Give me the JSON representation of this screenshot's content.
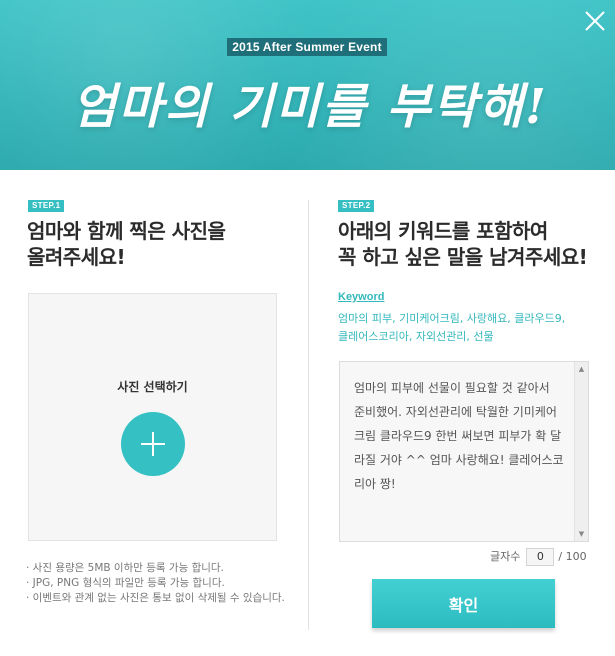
{
  "header": {
    "event_badge": "2015 After Summer Event",
    "title": "엄마의 기미를 부탁해!",
    "close_icon": "close-icon"
  },
  "step1": {
    "badge": "STEP.1",
    "title_line1": "엄마와 함께 찍은 사진을",
    "title_line2": "올려주세요!",
    "photo_select_label": "사진 선택하기",
    "add_icon": "plus-icon",
    "notes": [
      "· 사진 용량은 5MB 이하만 등록 가능 합니다.",
      "· JPG, PNG 형식의 파일만 등록 가능 합니다.",
      "· 이벤트와 관계 없는 사진은 통보 없이 삭제될 수 있습니다."
    ]
  },
  "step2": {
    "badge": "STEP.2",
    "title_line1": "아래의 키워드를 포함하여",
    "title_line2": "꼭 하고 싶은 말을 남겨주세요!",
    "keyword_label": "Keyword",
    "keywords_line1": "엄마의 피부, 기미케어크림, 사랑해요, 클라우드9,",
    "keywords_line2": "클레어스코리아, 자외선관리, 선물",
    "message_value": "엄마의 피부에 선물이 필요할 것 같아서 준비했어. 자외선관리에 탁월한 기미케어크림 클라우드9 한번 써보면 피부가 확 달라질 거야 ^^ 엄마 사랑해요! 클레어스코리아 짱!",
    "counter_label": "글자수",
    "counter_value": "0",
    "counter_max": "/ 100",
    "confirm_label": "확인"
  },
  "colors": {
    "accent": "#35bfc3",
    "header_bg": "#2fb3b7",
    "badge_bg": "#1f6f7a"
  }
}
